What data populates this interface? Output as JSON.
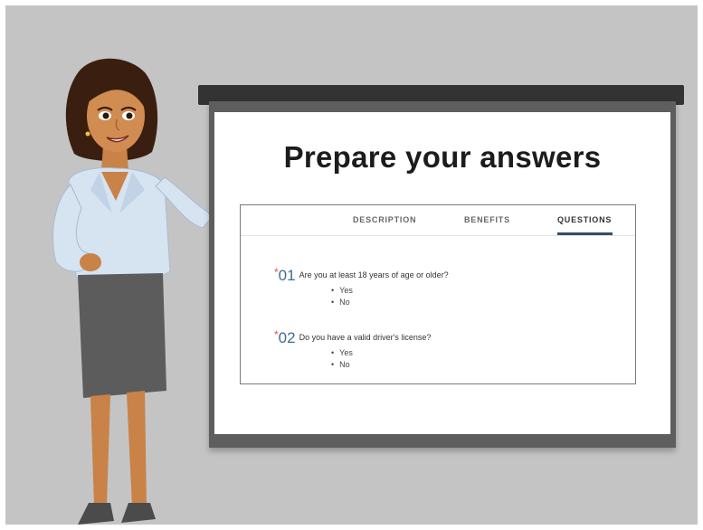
{
  "slide": {
    "title": "Prepare your answers"
  },
  "tabs": [
    {
      "label": "DESCRIPTION",
      "active": false
    },
    {
      "label": "BENEFITS",
      "active": false
    },
    {
      "label": "QUESTIONS",
      "active": true
    }
  ],
  "questions": [
    {
      "required_marker": "*",
      "number": "01",
      "text": "Are you at least 18 years of age or older?",
      "options": [
        "Yes",
        "No"
      ]
    },
    {
      "required_marker": "*",
      "number": "02",
      "text": "Do you have a valid driver's license?",
      "options": [
        "Yes",
        "No"
      ]
    }
  ],
  "colors": {
    "background": "#c4c4c4",
    "screen_frame": "#5e5e5e",
    "accent_number": "#3f6c96",
    "required_star": "#e0533d",
    "active_tab_underline": "#2f4f6a"
  }
}
